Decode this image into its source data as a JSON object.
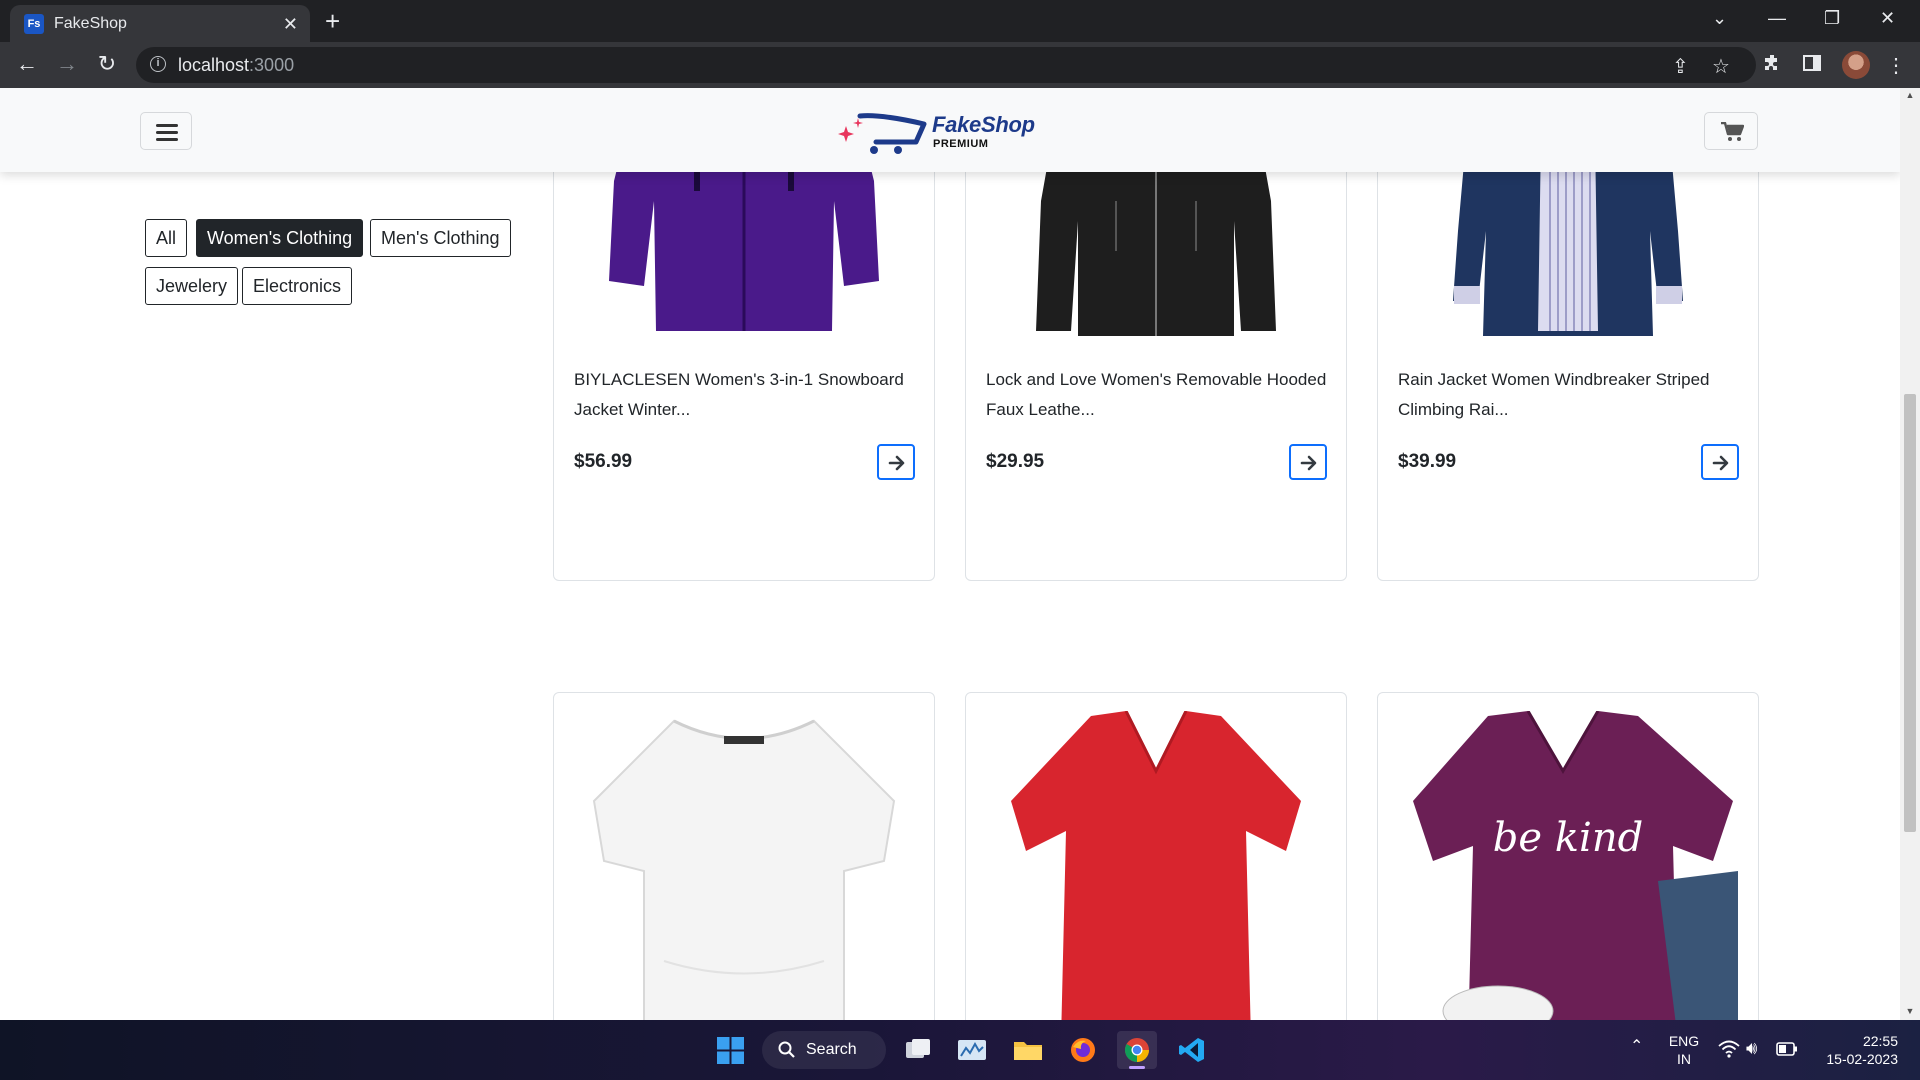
{
  "browser": {
    "tab_title": "FakeShop",
    "favicon_text": "Fs",
    "tab_close": "✕",
    "new_tab": "+",
    "url_host": "localhost",
    "url_port": ":3000"
  },
  "header": {
    "logo_name": "FakeShop",
    "logo_sub": "PREMIUM"
  },
  "filters": [
    {
      "label": "All",
      "active": false
    },
    {
      "label": "Women's Clothing",
      "active": true
    },
    {
      "label": "Men's Clothing",
      "active": false
    },
    {
      "label": "Jewelery",
      "active": false
    },
    {
      "label": "Electronics",
      "active": false
    }
  ],
  "products": [
    {
      "title": "BIYLACLESEN Women's 3-in-1 Snowboard Jacket Winter...",
      "price": "$56.99",
      "image": "purple-jacket"
    },
    {
      "title": "Lock and Love Women's Removable Hooded Faux Leathe...",
      "price": "$29.95",
      "image": "black-leather-jacket"
    },
    {
      "title": "Rain Jacket Women Windbreaker Striped Climbing Rai...",
      "price": "$39.99",
      "image": "navy-rain-jacket"
    },
    {
      "title": "",
      "price": "",
      "image": "white-top"
    },
    {
      "title": "",
      "price": "",
      "image": "red-v-neck-tshirt"
    },
    {
      "title": "",
      "price": "",
      "image": "purple-be-kind-tshirt"
    }
  ],
  "tshirt_print": "be kind",
  "taskbar": {
    "search_label": "Search",
    "lang_line1": "ENG",
    "lang_line2": "IN",
    "time": "22:55",
    "date": "15-02-2023"
  },
  "colors": {
    "active_filter": "#212529",
    "go_button": "#0d6efd",
    "logo_blue": "#1d3a8a"
  }
}
